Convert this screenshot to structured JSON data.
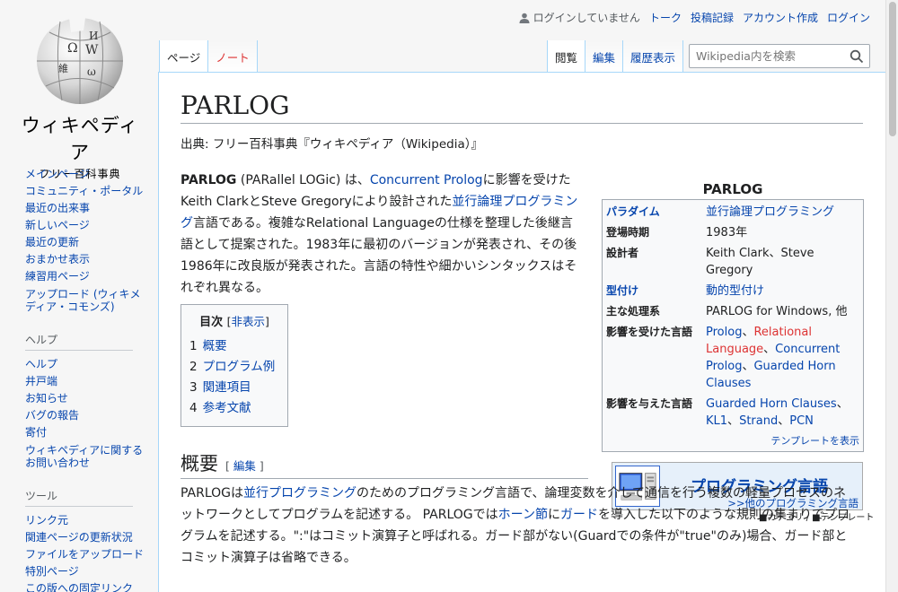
{
  "logo": {
    "wordmark": "ウィキペディア",
    "tagline": "フリー百科事典"
  },
  "sidebar": {
    "nav": [
      {
        "label": "メインページ"
      },
      {
        "label": "コミュニティ・ポータル"
      },
      {
        "label": "最近の出来事"
      },
      {
        "label": "新しいページ"
      },
      {
        "label": "最近の更新"
      },
      {
        "label": "おまかせ表示"
      },
      {
        "label": "練習用ページ"
      },
      {
        "label": "アップロード (ウィキメディア・コモンズ)"
      }
    ],
    "help_heading": "ヘルプ",
    "help": [
      {
        "label": "ヘルプ"
      },
      {
        "label": "井戸端"
      },
      {
        "label": "お知らせ"
      },
      {
        "label": "バグの報告"
      },
      {
        "label": "寄付"
      },
      {
        "label": "ウィキペディアに関するお問い合わせ"
      }
    ],
    "tools_heading": "ツール",
    "tools": [
      {
        "label": "リンク元"
      },
      {
        "label": "関連ページの更新状況"
      },
      {
        "label": "ファイルをアップロード"
      },
      {
        "label": "特別ページ"
      },
      {
        "label": "この版への固定リンク"
      }
    ]
  },
  "personal": {
    "not_logged_in": "ログインしていません",
    "talk": "トーク",
    "contributions": "投稿記録",
    "create_account": "アカウント作成",
    "login": "ログイン"
  },
  "tabs": {
    "page": "ページ",
    "note": "ノート",
    "read": "閲覧",
    "edit": "編集",
    "history": "履歴表示"
  },
  "search": {
    "placeholder": "Wikipedia内を検索"
  },
  "article": {
    "title": "PARLOG",
    "site_sub": "出典: フリー百科事典『ウィキペディア（Wikipedia）』",
    "intro": {
      "bold": "PARLOG",
      "t1": " (PARallel LOGic) は、",
      "l1": "Concurrent Prolog",
      "t2": "に影響を受けたKeith ClarkとSteve Gregoryにより設計された",
      "l2": "並行論理プログラミング",
      "t3": "言語である。複雑なRelational Languageの仕様を整理した後継言語として提案された。1983年に最初のバージョンが発表され、その後1986年に改良版が発表された。言語の特性や細かいシンタックスはそれぞれ異なる。"
    },
    "toc": {
      "title": "目次",
      "toggle_open": "[",
      "toggle": "非表示",
      "toggle_close": "]",
      "items": [
        {
          "num": "1",
          "label": "概要"
        },
        {
          "num": "2",
          "label": "プログラム例"
        },
        {
          "num": "3",
          "label": "関連項目"
        },
        {
          "num": "4",
          "label": "参考文献"
        }
      ]
    },
    "overview": {
      "heading": "概要",
      "edit_open": "[ ",
      "edit": "編集",
      "edit_close": " ]",
      "t1": "PARLOGは",
      "l1": "並行プログラミング",
      "t2": "のためのプログラミング言語で、論理変数を介して通信を行う複数の軽量プロセスのネットワークとしてプログラムを記述する。 PARLOGでは",
      "l2": "ホーン節",
      "t3": "に",
      "l3": "ガード",
      "t4": "を導入した以下のような規則の集まりでプログラムを記述する。\":\"はコミット演算子と呼ばれる。ガード部がない(Guardでの条件が\"true\"のみ)場合、ガード部とコミット演算子は省略できる。"
    }
  },
  "infobox": {
    "caption": "PARLOG",
    "rows": {
      "paradigm_k": "パラダイム",
      "paradigm_v": "並行論理プログラミング",
      "appeared_k": "登場時期",
      "appeared_v": "1983年",
      "designer_k": "設計者",
      "designer_v": "Keith Clark、Steve Gregory",
      "typing_k": "型付け",
      "typing_v": "動的型付け",
      "impl_k": "主な処理系",
      "impl_v": "PARLOG for Windows, 他",
      "influenced_by_k": "影響を受けた言語",
      "ib1": "Prolog",
      "ib_sep1": "、",
      "ib2": "Relational Language",
      "ib_sep2": "、",
      "ib3": "Concurrent Prolog",
      "ib_sep3": "、",
      "ib4": "Guarded Horn Clauses",
      "influenced_k": "影響を与えた言語",
      "if1": "Guarded Horn Clauses",
      "if_sep1": "、",
      "if2": "KL1",
      "if_sep2": "、",
      "if3": "Strand",
      "if_sep3": "、",
      "if4": "PCN"
    },
    "footer": "テンプレートを表示"
  },
  "portal": {
    "title": "プログラミング言語",
    "sub": ">>他のプログラミング言語",
    "links": "■カテゴリ / ■テンプレート"
  }
}
